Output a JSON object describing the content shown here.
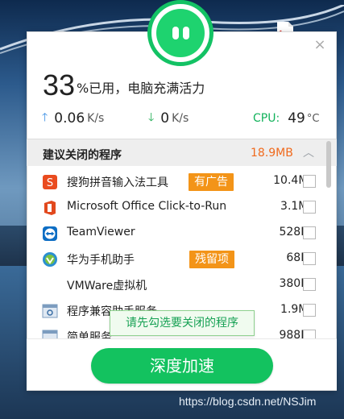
{
  "summary": {
    "usage_number": "33",
    "usage_text": "%已用，电脑充满活力",
    "upload_value": "0.06",
    "upload_unit": "K/s",
    "download_value": "0",
    "download_unit": "K/s",
    "cpu_label": "CPU:",
    "cpu_value": "49",
    "cpu_unit": "°C"
  },
  "list": {
    "title": "建议关闭的程序",
    "total_size": "18.9MB",
    "items": [
      {
        "name": "搜狗拼音输入法工具",
        "tag": "有广告",
        "size": "10.4MB",
        "icon": "sogou-icon"
      },
      {
        "name": "Microsoft Office Click-to-Run",
        "tag": "",
        "size": "3.1MB",
        "icon": "office-icon"
      },
      {
        "name": "TeamViewer",
        "tag": "",
        "size": "528KB",
        "icon": "teamviewer-icon"
      },
      {
        "name": "华为手机助手",
        "tag": "残留项",
        "size": "68KB",
        "icon": "huawei-icon"
      },
      {
        "name": "VMWare虚拟机",
        "tag": "",
        "size": "380KB",
        "icon": ""
      },
      {
        "name": "程序兼容助手服务",
        "tag": "",
        "size": "1.9MB",
        "icon": "compat-icon"
      },
      {
        "name": "简单服务",
        "tag": "",
        "size": "988KB",
        "icon": "service-icon"
      }
    ]
  },
  "tooltip": "请先勾选要关闭的程序",
  "action_button": "深度加速",
  "watermark": "https://blog.csdn.net/NSJim",
  "colors": {
    "accent": "#13c25f",
    "orange": "#f39418",
    "size_red": "#f06a1d"
  }
}
